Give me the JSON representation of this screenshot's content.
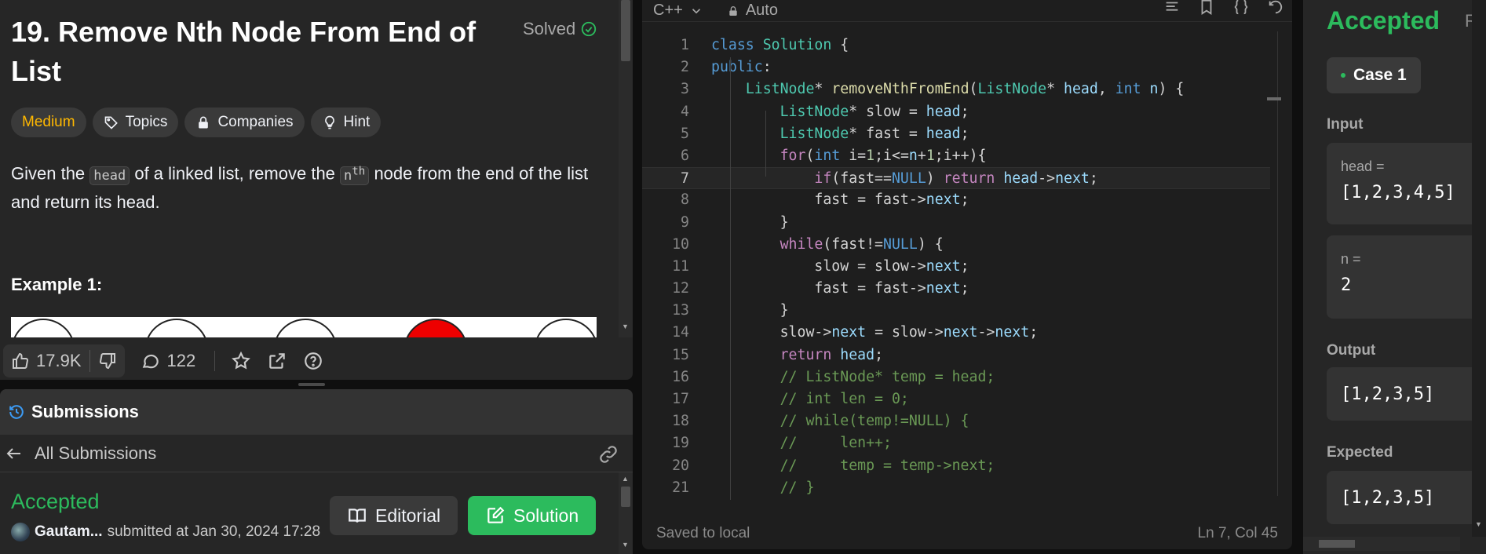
{
  "description": {
    "title": "19. Remove Nth Node From End of List",
    "solved_label": "Solved",
    "tags": [
      "Medium",
      "Topics",
      "Companies",
      "Hint"
    ],
    "para_before_head": "Given the ",
    "head_code": "head",
    "para_mid": " of a linked list, remove the ",
    "n_code": "n",
    "n_sup": "th",
    "para_end": " node from the end of the list and return its head.",
    "example_title": "Example 1:",
    "likes": "17.9K",
    "comments": "122"
  },
  "submissions": {
    "header": "Submissions",
    "all_label": "All Submissions",
    "status": "Accepted",
    "user": "Gautam...",
    "submitted_text": "submitted at Jan 30, 2024 17:28",
    "editorial_label": "Editorial",
    "solution_label": "Solution"
  },
  "editor": {
    "language": "C++",
    "mode": "Auto",
    "saved_text": "Saved to local",
    "cursor_pos": "Ln 7, Col 45",
    "current_line": 7,
    "lines": [
      "class Solution {",
      "public:",
      "    ListNode* removeNthFromEnd(ListNode* head, int n) {",
      "        ListNode* slow = head;",
      "        ListNode* fast = head;",
      "        for(int i=1;i<=n+1;i++){",
      "            if(fast==NULL) return head->next;",
      "            fast = fast->next;",
      "        }",
      "        while(fast!=NULL) {",
      "            slow = slow->next;",
      "            fast = fast->next;",
      "        }",
      "        slow->next = slow->next->next;",
      "        return head;",
      "        // ListNode* temp = head;",
      "        // int len = 0;",
      "        // while(temp!=NULL) {",
      "        //     len++;",
      "        //     temp = temp->next;",
      "        // }"
    ]
  },
  "result": {
    "status": "Accepted",
    "status_suffix": "R",
    "case_label": "Case 1",
    "input_label": "Input",
    "inputs": [
      {
        "name": "head =",
        "value": "[1,2,3,4,5]"
      },
      {
        "name": "n =",
        "value": "2"
      }
    ],
    "output_label": "Output",
    "output_value": "[1,2,3,5]",
    "expected_label": "Expected",
    "expected_value": "[1,2,3,5]"
  },
  "colors": {
    "accent_green": "#2cbb5d",
    "medium": "#ffb800"
  }
}
